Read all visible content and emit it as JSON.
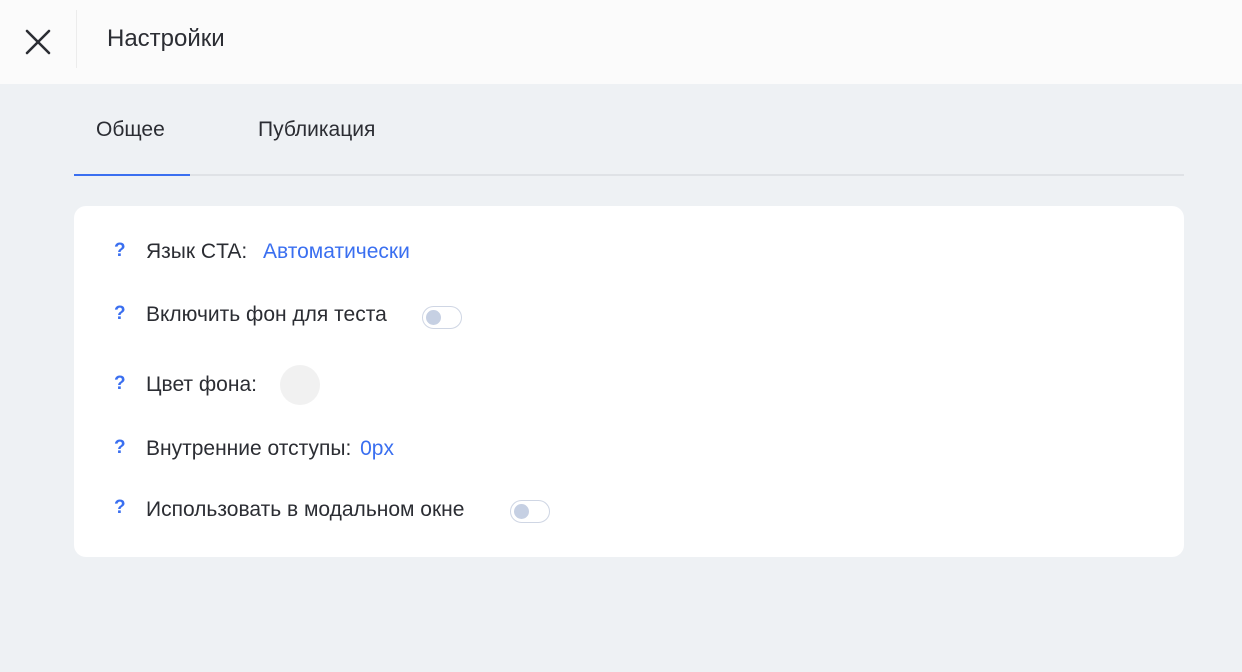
{
  "header": {
    "title": "Настройки",
    "close_icon": "close-icon"
  },
  "tabs": [
    {
      "label": "Общее",
      "active": true
    },
    {
      "label": "Публикация",
      "active": false
    }
  ],
  "settings": {
    "help_symbol": "?",
    "cta_language": {
      "label": "Язык CTA:",
      "value": "Автоматически"
    },
    "test_background": {
      "label": "Включить фон для теста",
      "enabled": false
    },
    "background_color": {
      "label": "Цвет фона:",
      "color": "#f1f1f1"
    },
    "padding": {
      "label": "Внутренние отступы:",
      "value": "0px"
    },
    "modal": {
      "label": "Использовать в модальном окне",
      "enabled": false
    }
  },
  "colors": {
    "accent": "#3a6ff0",
    "page_background": "#eef1f4",
    "card_background": "#ffffff",
    "toggle_knob": "#c6d0e3"
  }
}
